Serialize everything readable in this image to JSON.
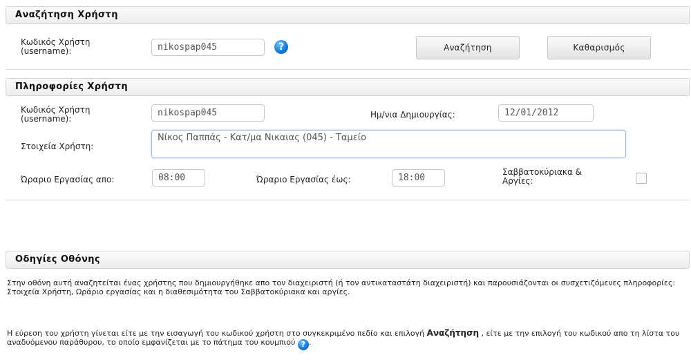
{
  "search": {
    "title": "Αναζήτηση Χρήστη",
    "username_label_line1": "Κωδικός Χρήστη",
    "username_label_line2": "(username):",
    "username_value": "nikospap045",
    "search_button": "Αναζήτηση",
    "clear_button": "Καθαρισμός"
  },
  "info": {
    "title": "Πληροφορίες Χρήστη",
    "username_label_line1": "Κωδικός Χρήστη",
    "username_label_line2": "(username):",
    "username_value": "nikospap045",
    "created_label": "Ημ/νια Δημιουργίας:",
    "created_value": "12/01/2012",
    "details_label": "Στοιχεία Χρήστη:",
    "details_value": "Νίκος Παππάς - Κατ/μα Νικαιας (045) - Ταμείο",
    "hours_from_label": "Ώραριο Εργασίας απο:",
    "hours_from_value": "08:00",
    "hours_to_label": "Ώραριο Εργασίας έως:",
    "hours_to_value": "18:00",
    "weekend_label_line1": "Σαββατοκύριακα &",
    "weekend_label_line2": "Αργίες:",
    "weekend_checked": false
  },
  "instructions": {
    "title": "Οδηγίες Οθόνης",
    "para1": "Στην οθόνη αυτή αναζητείται ένας χρήστης που δημιουργήθηκε απο τον διαχειριστή (ή τον αντικαταστάτη διαχειριστή) και παρουσιάζονται οι συσχετιζόμενες πληροφορίες: Στοιχεία Χρήστη, Ωράριο εργασίας και η διαθεσιμότητα του Σαββατοκύριακα και αργίες.",
    "para2_a": "Η εύρεση του χρήστη γίνεται είτε με την εισαγωγή του κωδικού χρήστη στο συγκεκριμένο πεδίο και επιλογή ",
    "para2_bold": "Αναζήτηση",
    "para2_b": " , είτε με την επιλογή του κωδικού απο τη λίστα του αναδυόμενου παράθυρου, το οποίο εμφανίζεται με το πάτημα του κουμπιού ",
    "para2_end": ".",
    "help_glyph": "?"
  }
}
